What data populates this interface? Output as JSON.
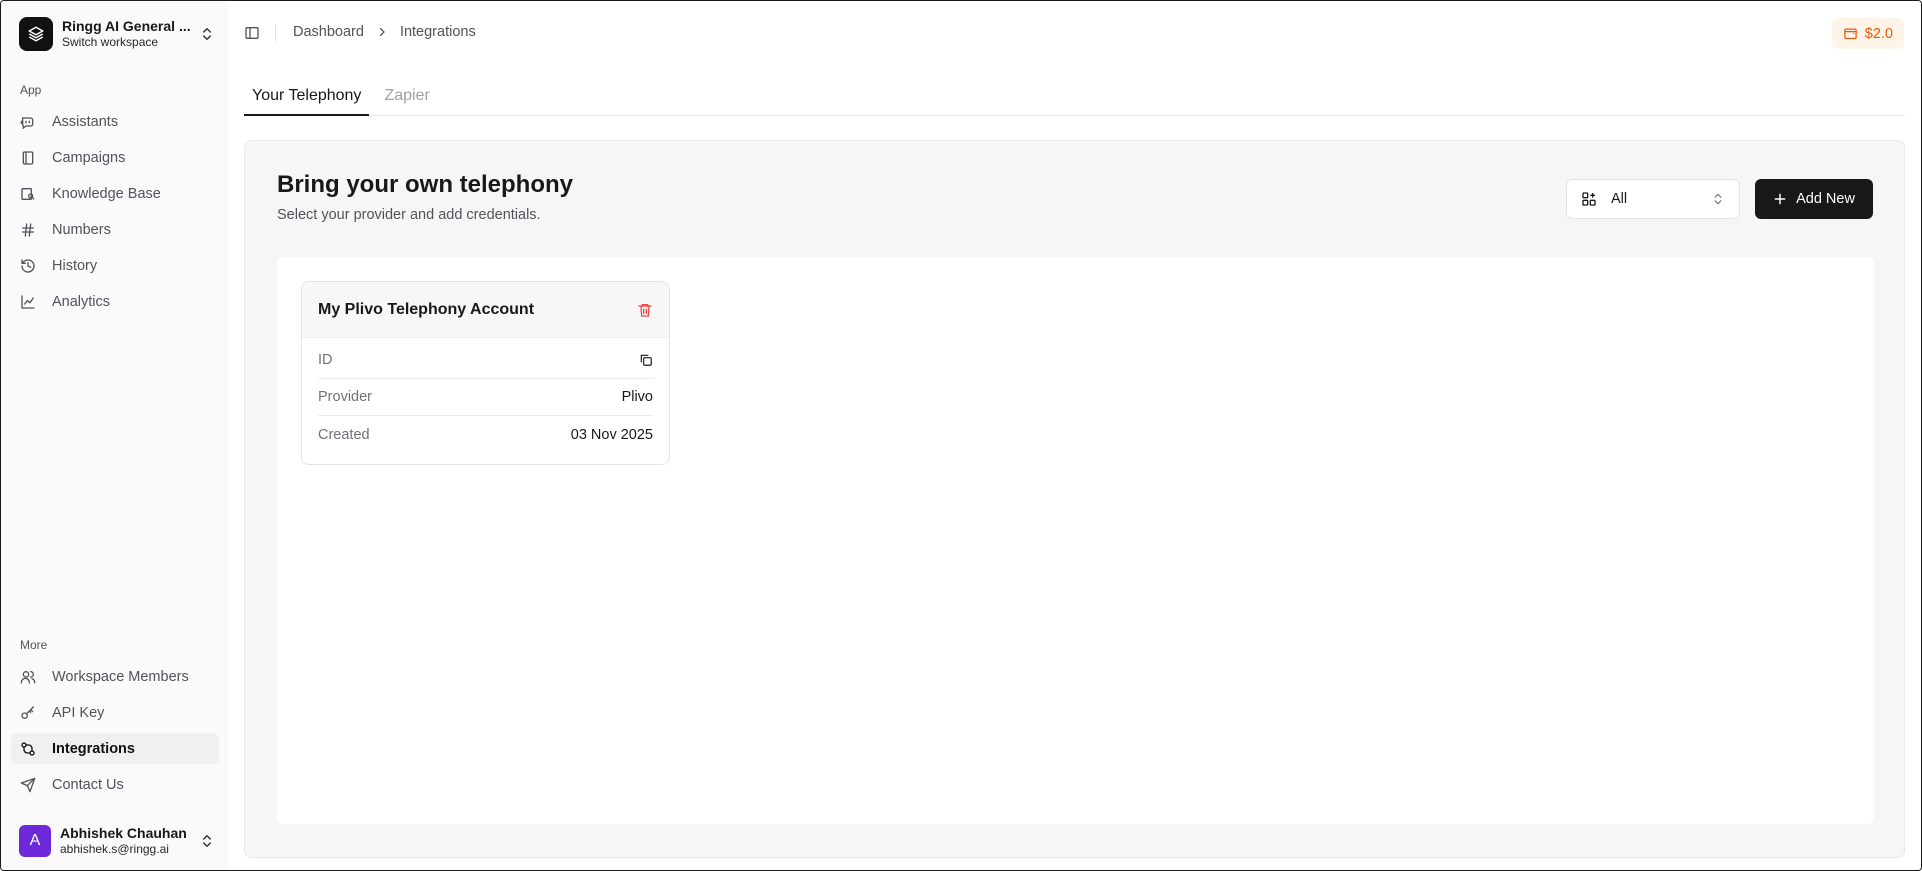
{
  "workspace": {
    "name": "Ringg AI General ...",
    "subtitle": "Switch workspace"
  },
  "sidebar": {
    "app_label": "App",
    "app_items": [
      {
        "label": "Assistants",
        "icon": "bot-icon"
      },
      {
        "label": "Campaigns",
        "icon": "campaign-icon"
      },
      {
        "label": "Knowledge Base",
        "icon": "book-icon"
      },
      {
        "label": "Numbers",
        "icon": "hash-icon"
      },
      {
        "label": "History",
        "icon": "history-icon"
      },
      {
        "label": "Analytics",
        "icon": "chart-icon"
      }
    ],
    "more_label": "More",
    "more_items": [
      {
        "label": "Workspace Members",
        "icon": "users-icon"
      },
      {
        "label": "API Key",
        "icon": "key-icon"
      },
      {
        "label": "Integrations",
        "icon": "integrations-icon",
        "active": true
      },
      {
        "label": "Contact Us",
        "icon": "send-icon"
      }
    ]
  },
  "user": {
    "initial": "A",
    "name": "Abhishek Chauhan",
    "email": "abhishek.s@ringg.ai"
  },
  "breadcrumb": [
    "Dashboard",
    "Integrations"
  ],
  "credit": {
    "amount": "$2.0"
  },
  "tabs": [
    {
      "label": "Your Telephony",
      "active": true
    },
    {
      "label": "Zapier",
      "active": false
    }
  ],
  "panel": {
    "title": "Bring your own telephony",
    "subtitle": "Select your provider and add credentials.",
    "filter_value": "All",
    "add_label": "Add New"
  },
  "card": {
    "title": "My Plivo Telephony Account",
    "rows": [
      {
        "label": "ID",
        "value": ""
      },
      {
        "label": "Provider",
        "value": "Plivo"
      },
      {
        "label": "Created",
        "value": "03 Nov 2025"
      }
    ]
  },
  "colors": {
    "accent": "#18181b",
    "credit": "#ea580c",
    "danger": "#ef4444",
    "avatar": "#6d28d9"
  }
}
